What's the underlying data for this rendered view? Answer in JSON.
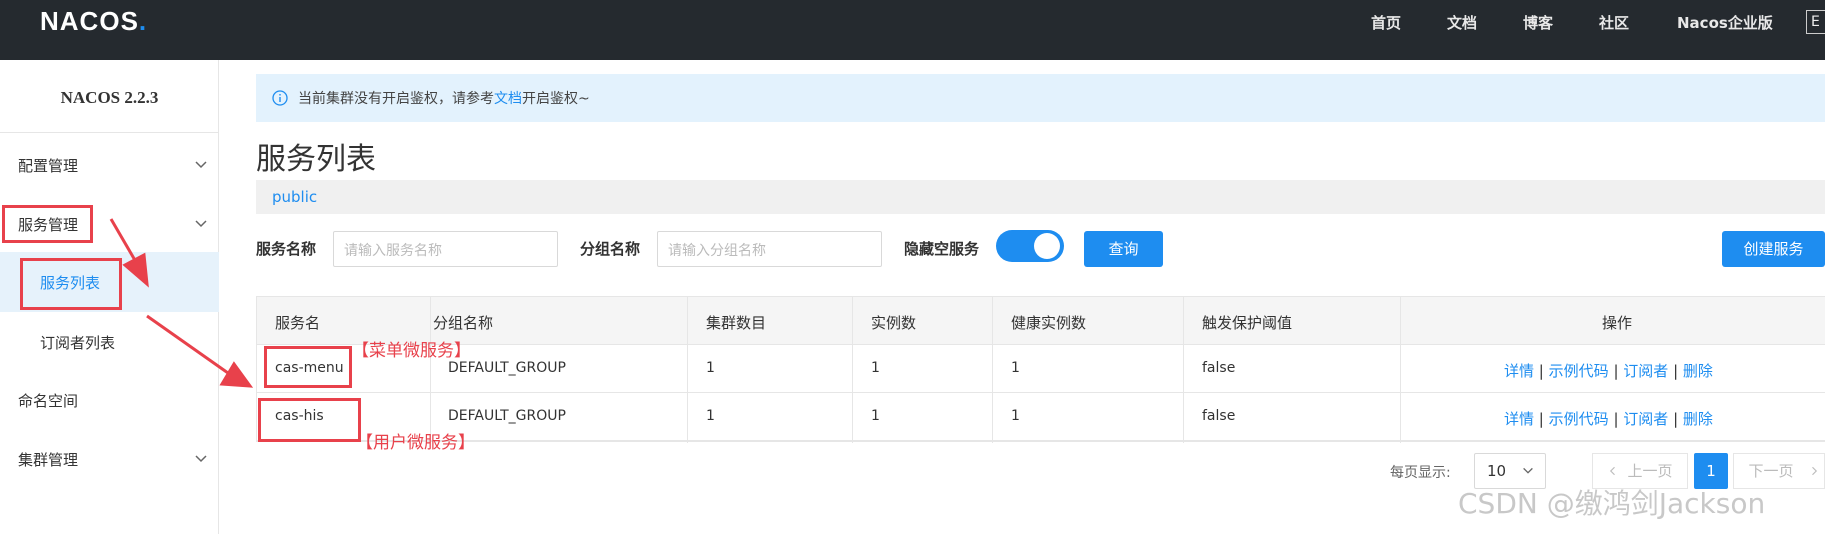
{
  "header": {
    "logo_main": "NAC",
    "logo_o": "O",
    "logo_s": "S",
    "logo_dot": ".",
    "nav": [
      "首页",
      "文档",
      "博客",
      "社区",
      "Nacos企业版"
    ],
    "lang": "E"
  },
  "sidebar": {
    "version": "NACOS 2.2.3",
    "items": [
      {
        "label": "配置管理"
      },
      {
        "label": "服务管理"
      },
      {
        "label": "服务列表"
      },
      {
        "label": "订阅者列表"
      },
      {
        "label": "命名空间"
      },
      {
        "label": "集群管理"
      }
    ]
  },
  "notice": {
    "text_before": "当前集群没有开启鉴权，请参考",
    "link": "文档",
    "text_after": "开启鉴权~"
  },
  "main": {
    "title": "服务列表",
    "namespace": "public"
  },
  "filters": {
    "service_name_label": "服务名称",
    "service_name_placeholder": "请输入服务名称",
    "group_name_label": "分组名称",
    "group_name_placeholder": "请输入分组名称",
    "hide_empty_label": "隐藏空服务",
    "hide_empty_on": true,
    "query_button": "查询",
    "create_button": "创建服务"
  },
  "table": {
    "columns": [
      "服务名",
      "分组名称",
      "集群数目",
      "实例数",
      "健康实例数",
      "触发保护阈值",
      "操作"
    ],
    "rows": [
      {
        "name": "cas-menu",
        "group": "DEFAULT_GROUP",
        "clusters": "1",
        "instances": "1",
        "healthy": "1",
        "threshold": "false"
      },
      {
        "name": "cas-his",
        "group": "DEFAULT_GROUP",
        "clusters": "1",
        "instances": "1",
        "healthy": "1",
        "threshold": "false"
      }
    ],
    "ops": {
      "detail": "详情",
      "sample": "示例代码",
      "subscriber": "订阅者",
      "delete": "删除",
      "sep": "|"
    }
  },
  "pagination": {
    "per_page_label": "每页显示:",
    "per_page_value": "10",
    "prev": "上一页",
    "current": "1",
    "next": "下一页"
  },
  "annotations": {
    "menu_service": "【菜单微服务】",
    "user_service": "【用户微服务】",
    "watermark": "CSDN @缴鸿剑Jackson"
  },
  "colors": {
    "primary": "#1e8df0",
    "topbar": "#252a2f",
    "annotation_red": "#e8414b"
  }
}
